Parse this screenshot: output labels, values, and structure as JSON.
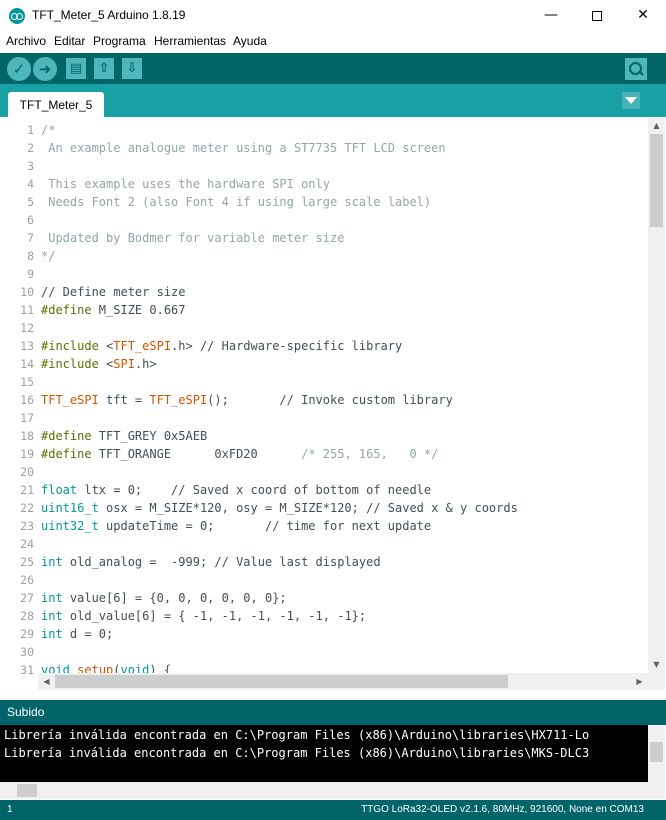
{
  "window": {
    "title": "TFT_Meter_5 Arduino 1.8.19",
    "minimize_glyph": "—",
    "close_glyph": "✕"
  },
  "menu": [
    "Archivo",
    "Editar",
    "Programa",
    "Herramientas",
    "Ayuda"
  ],
  "toolbar": {
    "verify_glyph": "✓",
    "upload_glyph": "➜",
    "new_glyph": "▤",
    "open_glyph": "⇧",
    "save_glyph": "⇩"
  },
  "tabs": [
    {
      "label": "TFT_Meter_5"
    }
  ],
  "editor": {
    "lines": [
      {
        "n": "1",
        "tokens": [
          {
            "t": "/*",
            "c": "comment"
          }
        ]
      },
      {
        "n": "2",
        "tokens": [
          {
            "t": " An example analogue meter using a ST7735 TFT LCD screen",
            "c": "comment"
          }
        ]
      },
      {
        "n": "3",
        "tokens": []
      },
      {
        "n": "4",
        "tokens": [
          {
            "t": " This example uses the hardware SPI only",
            "c": "comment"
          }
        ]
      },
      {
        "n": "5",
        "tokens": [
          {
            "t": " Needs Font 2 (also Font 4 if using large scale label)",
            "c": "comment"
          }
        ]
      },
      {
        "n": "6",
        "tokens": []
      },
      {
        "n": "7",
        "tokens": [
          {
            "t": " Updated by Bodmer for variable meter size",
            "c": "comment"
          }
        ]
      },
      {
        "n": "8",
        "tokens": [
          {
            "t": "*/",
            "c": "comment"
          }
        ]
      },
      {
        "n": "9",
        "tokens": []
      },
      {
        "n": "10",
        "tokens": [
          {
            "t": "// Define meter size",
            "c": "plain"
          }
        ]
      },
      {
        "n": "11",
        "tokens": [
          {
            "t": "#define",
            "c": "pp"
          },
          {
            "t": " M_SIZE 0.667",
            "c": "plain"
          }
        ]
      },
      {
        "n": "12",
        "tokens": []
      },
      {
        "n": "13",
        "tokens": [
          {
            "t": "#include",
            "c": "pp"
          },
          {
            "t": " <",
            "c": "plain"
          },
          {
            "t": "TFT_eSPI",
            "c": "lib"
          },
          {
            "t": ".h> // Hardware-specific library",
            "c": "plain"
          }
        ]
      },
      {
        "n": "14",
        "tokens": [
          {
            "t": "#include",
            "c": "pp"
          },
          {
            "t": " <",
            "c": "plain"
          },
          {
            "t": "SPI",
            "c": "lib"
          },
          {
            "t": ".h>",
            "c": "plain"
          }
        ]
      },
      {
        "n": "15",
        "tokens": []
      },
      {
        "n": "16",
        "tokens": [
          {
            "t": "TFT_eSPI",
            "c": "lib"
          },
          {
            "t": " tft = ",
            "c": "plain"
          },
          {
            "t": "TFT_eSPI",
            "c": "lib"
          },
          {
            "t": "();       // Invoke custom library",
            "c": "plain"
          }
        ]
      },
      {
        "n": "17",
        "tokens": []
      },
      {
        "n": "18",
        "tokens": [
          {
            "t": "#define",
            "c": "pp"
          },
          {
            "t": " TFT_GREY 0x5AEB",
            "c": "plain"
          }
        ]
      },
      {
        "n": "19",
        "tokens": [
          {
            "t": "#define",
            "c": "pp"
          },
          {
            "t": " TFT_ORANGE      0xFD20      ",
            "c": "plain"
          },
          {
            "t": "/* 255, 165,   0 */",
            "c": "comment"
          }
        ]
      },
      {
        "n": "20",
        "tokens": []
      },
      {
        "n": "21",
        "tokens": [
          {
            "t": "float",
            "c": "type"
          },
          {
            "t": " ltx = 0;    // Saved x coord of bottom of needle",
            "c": "plain"
          }
        ]
      },
      {
        "n": "22",
        "tokens": [
          {
            "t": "uint16_t",
            "c": "type"
          },
          {
            "t": " osx = M_SIZE*120, osy = M_SIZE*120; // Saved x & y coords",
            "c": "plain"
          }
        ]
      },
      {
        "n": "23",
        "tokens": [
          {
            "t": "uint32_t",
            "c": "type"
          },
          {
            "t": " updateTime = 0;       // time for next update",
            "c": "plain"
          }
        ]
      },
      {
        "n": "24",
        "tokens": []
      },
      {
        "n": "25",
        "tokens": [
          {
            "t": "int",
            "c": "type"
          },
          {
            "t": " old_analog =  -999; // Value last displayed",
            "c": "plain"
          }
        ]
      },
      {
        "n": "26",
        "tokens": []
      },
      {
        "n": "27",
        "tokens": [
          {
            "t": "int",
            "c": "type"
          },
          {
            "t": " value[6] = {0, 0, 0, 0, 0, 0};",
            "c": "plain"
          }
        ]
      },
      {
        "n": "28",
        "tokens": [
          {
            "t": "int",
            "c": "type"
          },
          {
            "t": " old_value[6] = { -1, -1, -1, -1, -1, -1};",
            "c": "plain"
          }
        ]
      },
      {
        "n": "29",
        "tokens": [
          {
            "t": "int",
            "c": "type"
          },
          {
            "t": " d = 0;",
            "c": "plain"
          }
        ]
      },
      {
        "n": "30",
        "tokens": []
      },
      {
        "n": "31",
        "tokens": [
          {
            "t": "void",
            "c": "type"
          },
          {
            "t": " ",
            "c": "plain"
          },
          {
            "t": "setup",
            "c": "lib"
          },
          {
            "t": "(",
            "c": "plain"
          },
          {
            "t": "void",
            "c": "type"
          },
          {
            "t": ") {",
            "c": "plain"
          }
        ]
      }
    ]
  },
  "scroll": {
    "up_glyph": "▲",
    "down_glyph": "▼",
    "left_glyph": "◀",
    "right_glyph": "▶"
  },
  "status": {
    "text": "Subido"
  },
  "console": {
    "lines": [
      "Librería inválida encontrada en C:\\Program Files (x86)\\Arduino\\libraries\\HX711-Lo",
      "Librería inválida encontrada en C:\\Program Files (x86)\\Arduino\\libraries\\MKS-DLC3"
    ]
  },
  "footer": {
    "line": "1",
    "board": "TTGO LoRa32-OLED v2.1.6, 80MHz, 921600, None en COM13"
  },
  "colors": {
    "toolbar": "#006468",
    "tabbar": "#17a1a5",
    "button": "#4db7bb",
    "comment": "#95a5a6",
    "preprocessor": "#5e6d03",
    "type": "#00979c",
    "library": "#d35400"
  },
  "icons": {
    "app": "arduino-logo-icon",
    "verify": "checkmark-icon",
    "upload": "right-arrow-icon",
    "new": "new-file-icon",
    "open": "open-arrow-icon",
    "save": "save-arrow-icon",
    "serial_monitor": "magnifier-icon",
    "tab_menu": "chevron-down-icon"
  }
}
